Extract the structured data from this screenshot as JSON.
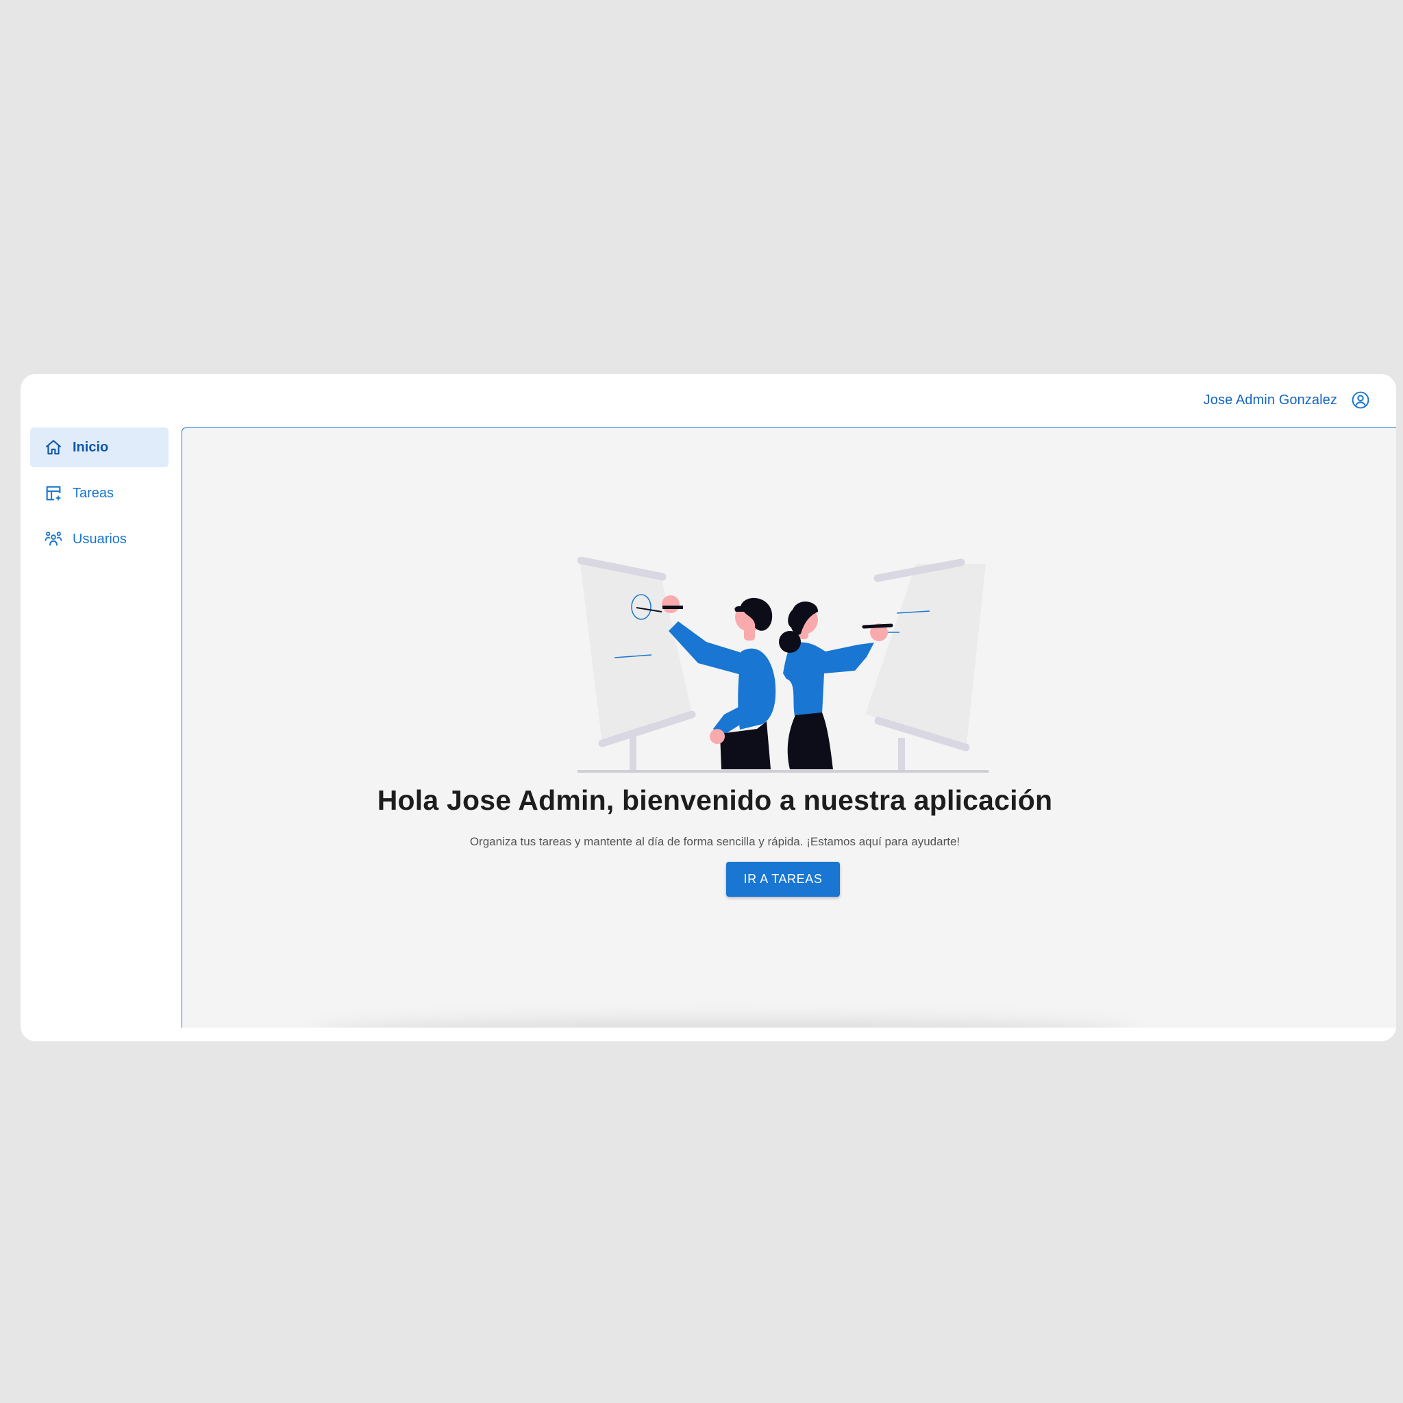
{
  "header": {
    "user_name": "Jose Admin Gonzalez",
    "user_icon": "account-circle-icon"
  },
  "sidebar": {
    "items": [
      {
        "label": "Inicio",
        "icon": "home-icon",
        "active": true
      },
      {
        "label": "Tareas",
        "icon": "table-edit-icon",
        "active": false
      },
      {
        "label": "Usuarios",
        "icon": "group-icon",
        "active": false
      }
    ]
  },
  "main": {
    "title": "Hola Jose Admin, bienvenido a nuestra aplicación",
    "subtitle": "Organiza tus tareas y mantente al día de forma sencilla y rápida. ¡Estamos aquí para ayudarte!",
    "cta_label": "IR A TAREAS",
    "illustration": "two-people-at-whiteboards"
  },
  "colors": {
    "accent": "#1976d2",
    "accent_dark": "#0d56a8",
    "active_bg": "#e1ecfa",
    "page_bg": "#e6e6e6",
    "panel_bg": "#f4f4f4"
  }
}
